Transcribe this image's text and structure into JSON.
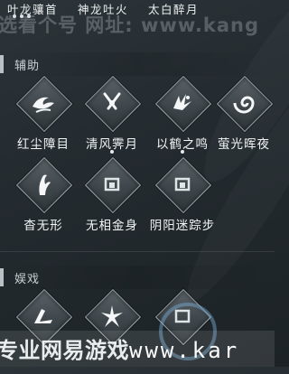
{
  "top_labels": [
    "叶龙骧首",
    "神龙吐火",
    "太白醉月"
  ],
  "watermark_top": "选看个号  网址: www.kang",
  "watermark_bottom": {
    "prefix": "专业网易游戏",
    "url": "www.kar"
  },
  "sections": {
    "assist": {
      "title": "辅助",
      "skills": [
        {
          "name": "红尘障目",
          "icon": "swirl-blade-icon"
        },
        {
          "name": "清风霁月",
          "icon": "crossed-blades-icon"
        },
        {
          "name": "以鹤之鸣",
          "icon": "crane-icon"
        },
        {
          "name": "萤光晖夜",
          "icon": "spiral-icon"
        },
        {
          "name": "杳无形",
          "icon": "ghost-leap-icon"
        },
        {
          "name": "无相金身",
          "icon": "locked-slot-icon"
        },
        {
          "name": "阴阳迷踪步",
          "icon": "locked-slot-icon"
        }
      ]
    },
    "entertainment": {
      "title": "娱戏",
      "skills": [
        {
          "icon": "kick-icon"
        },
        {
          "icon": "star-burst-icon"
        },
        {
          "icon": "locked-slot-icon"
        }
      ]
    }
  },
  "colors": {
    "background": "#252c31",
    "marker": "#cdb17a",
    "text": "#f2f4f5"
  }
}
